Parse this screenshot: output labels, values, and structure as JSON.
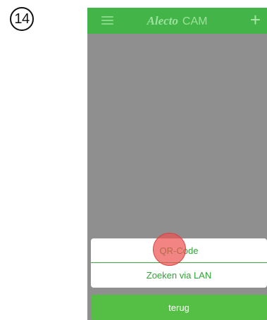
{
  "step": {
    "number": "14"
  },
  "appbar": {
    "brand": "Alecto",
    "title_suffix": "CAM",
    "menu_icon": "hamburger-menu-icon",
    "add_icon": "plus-icon"
  },
  "sheet": {
    "options": [
      "QR-Code",
      "Zoeken via LAN"
    ]
  },
  "cancel": {
    "label": "terug"
  },
  "colors": {
    "appbar": "#43b447",
    "accent_text": "#2fa535",
    "button": "#55bf45",
    "overlay": "#8f8f8f",
    "touch_indicator": "#ec5050"
  }
}
